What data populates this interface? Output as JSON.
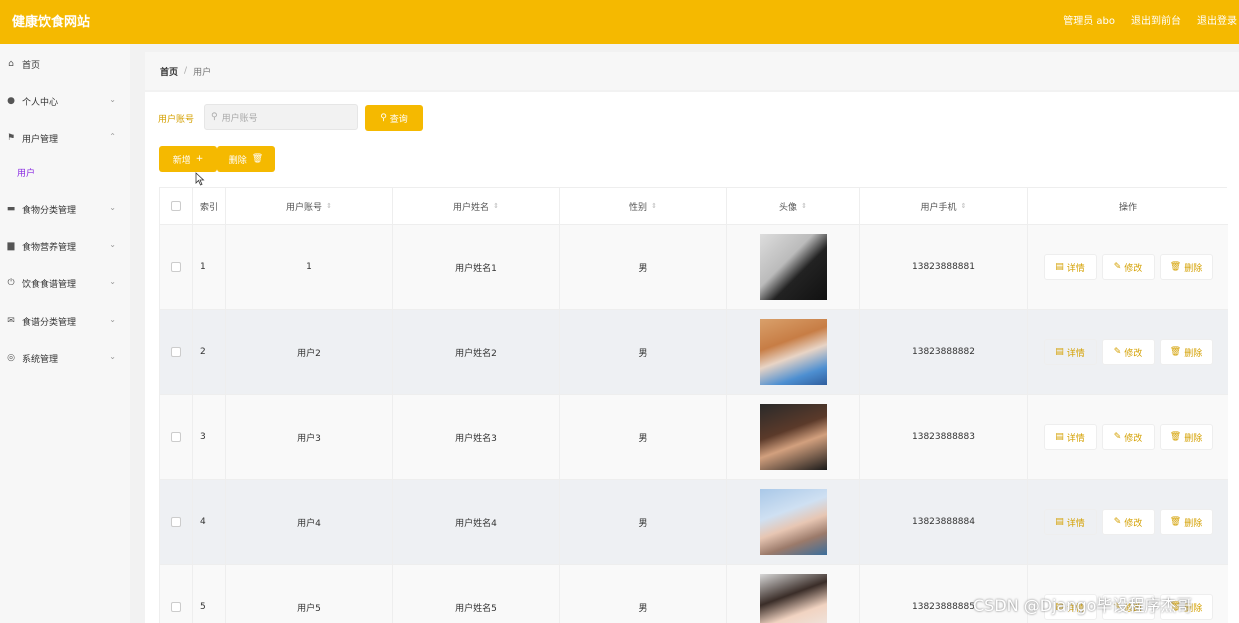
{
  "header": {
    "brand": "健康饮食网站",
    "admin_label": "管理员 abo",
    "back_front": "退出到前台",
    "logout": "退出登录"
  },
  "sidebar": {
    "items": [
      {
        "label": "首页",
        "icon": "home-icon"
      },
      {
        "label": "个人中心",
        "icon": "user-icon"
      },
      {
        "label": "用户管理",
        "icon": "flag-icon"
      },
      {
        "label": "食物分类管理",
        "icon": "box-icon"
      },
      {
        "label": "食物营养管理",
        "icon": "card-icon"
      },
      {
        "label": "饮食食谱管理",
        "icon": "power-icon"
      },
      {
        "label": "食谱分类管理",
        "icon": "mail-icon"
      },
      {
        "label": "系统管理",
        "icon": "compass-icon"
      }
    ],
    "submenu_label": "用户"
  },
  "breadcrumb": {
    "home": "首页",
    "separator": "/",
    "current": "用户"
  },
  "search": {
    "label": "用户账号",
    "placeholder": "用户账号",
    "button": "查询"
  },
  "actions": {
    "add": "新增",
    "delete": "删除"
  },
  "table": {
    "headers": [
      "索引",
      "用户账号",
      "用户姓名",
      "性别",
      "头像",
      "用户手机",
      "操作"
    ],
    "rows": [
      {
        "index": "1",
        "account": "1",
        "name": "用户姓名1",
        "gender": "男",
        "phone": "13823888881"
      },
      {
        "index": "2",
        "account": "用户2",
        "name": "用户姓名2",
        "gender": "男",
        "phone": "13823888882"
      },
      {
        "index": "3",
        "account": "用户3",
        "name": "用户姓名3",
        "gender": "男",
        "phone": "13823888883"
      },
      {
        "index": "4",
        "account": "用户4",
        "name": "用户姓名4",
        "gender": "男",
        "phone": "13823888884"
      },
      {
        "index": "5",
        "account": "用户5",
        "name": "用户姓名5",
        "gender": "男",
        "phone": "13823888885"
      }
    ],
    "ops": {
      "detail": "详情",
      "edit": "修改",
      "delete": "删除"
    }
  },
  "watermark": "CSDN @Django毕设程序杰哥",
  "colors": {
    "accent": "#f5b900",
    "accent_text": "#d4a000"
  }
}
